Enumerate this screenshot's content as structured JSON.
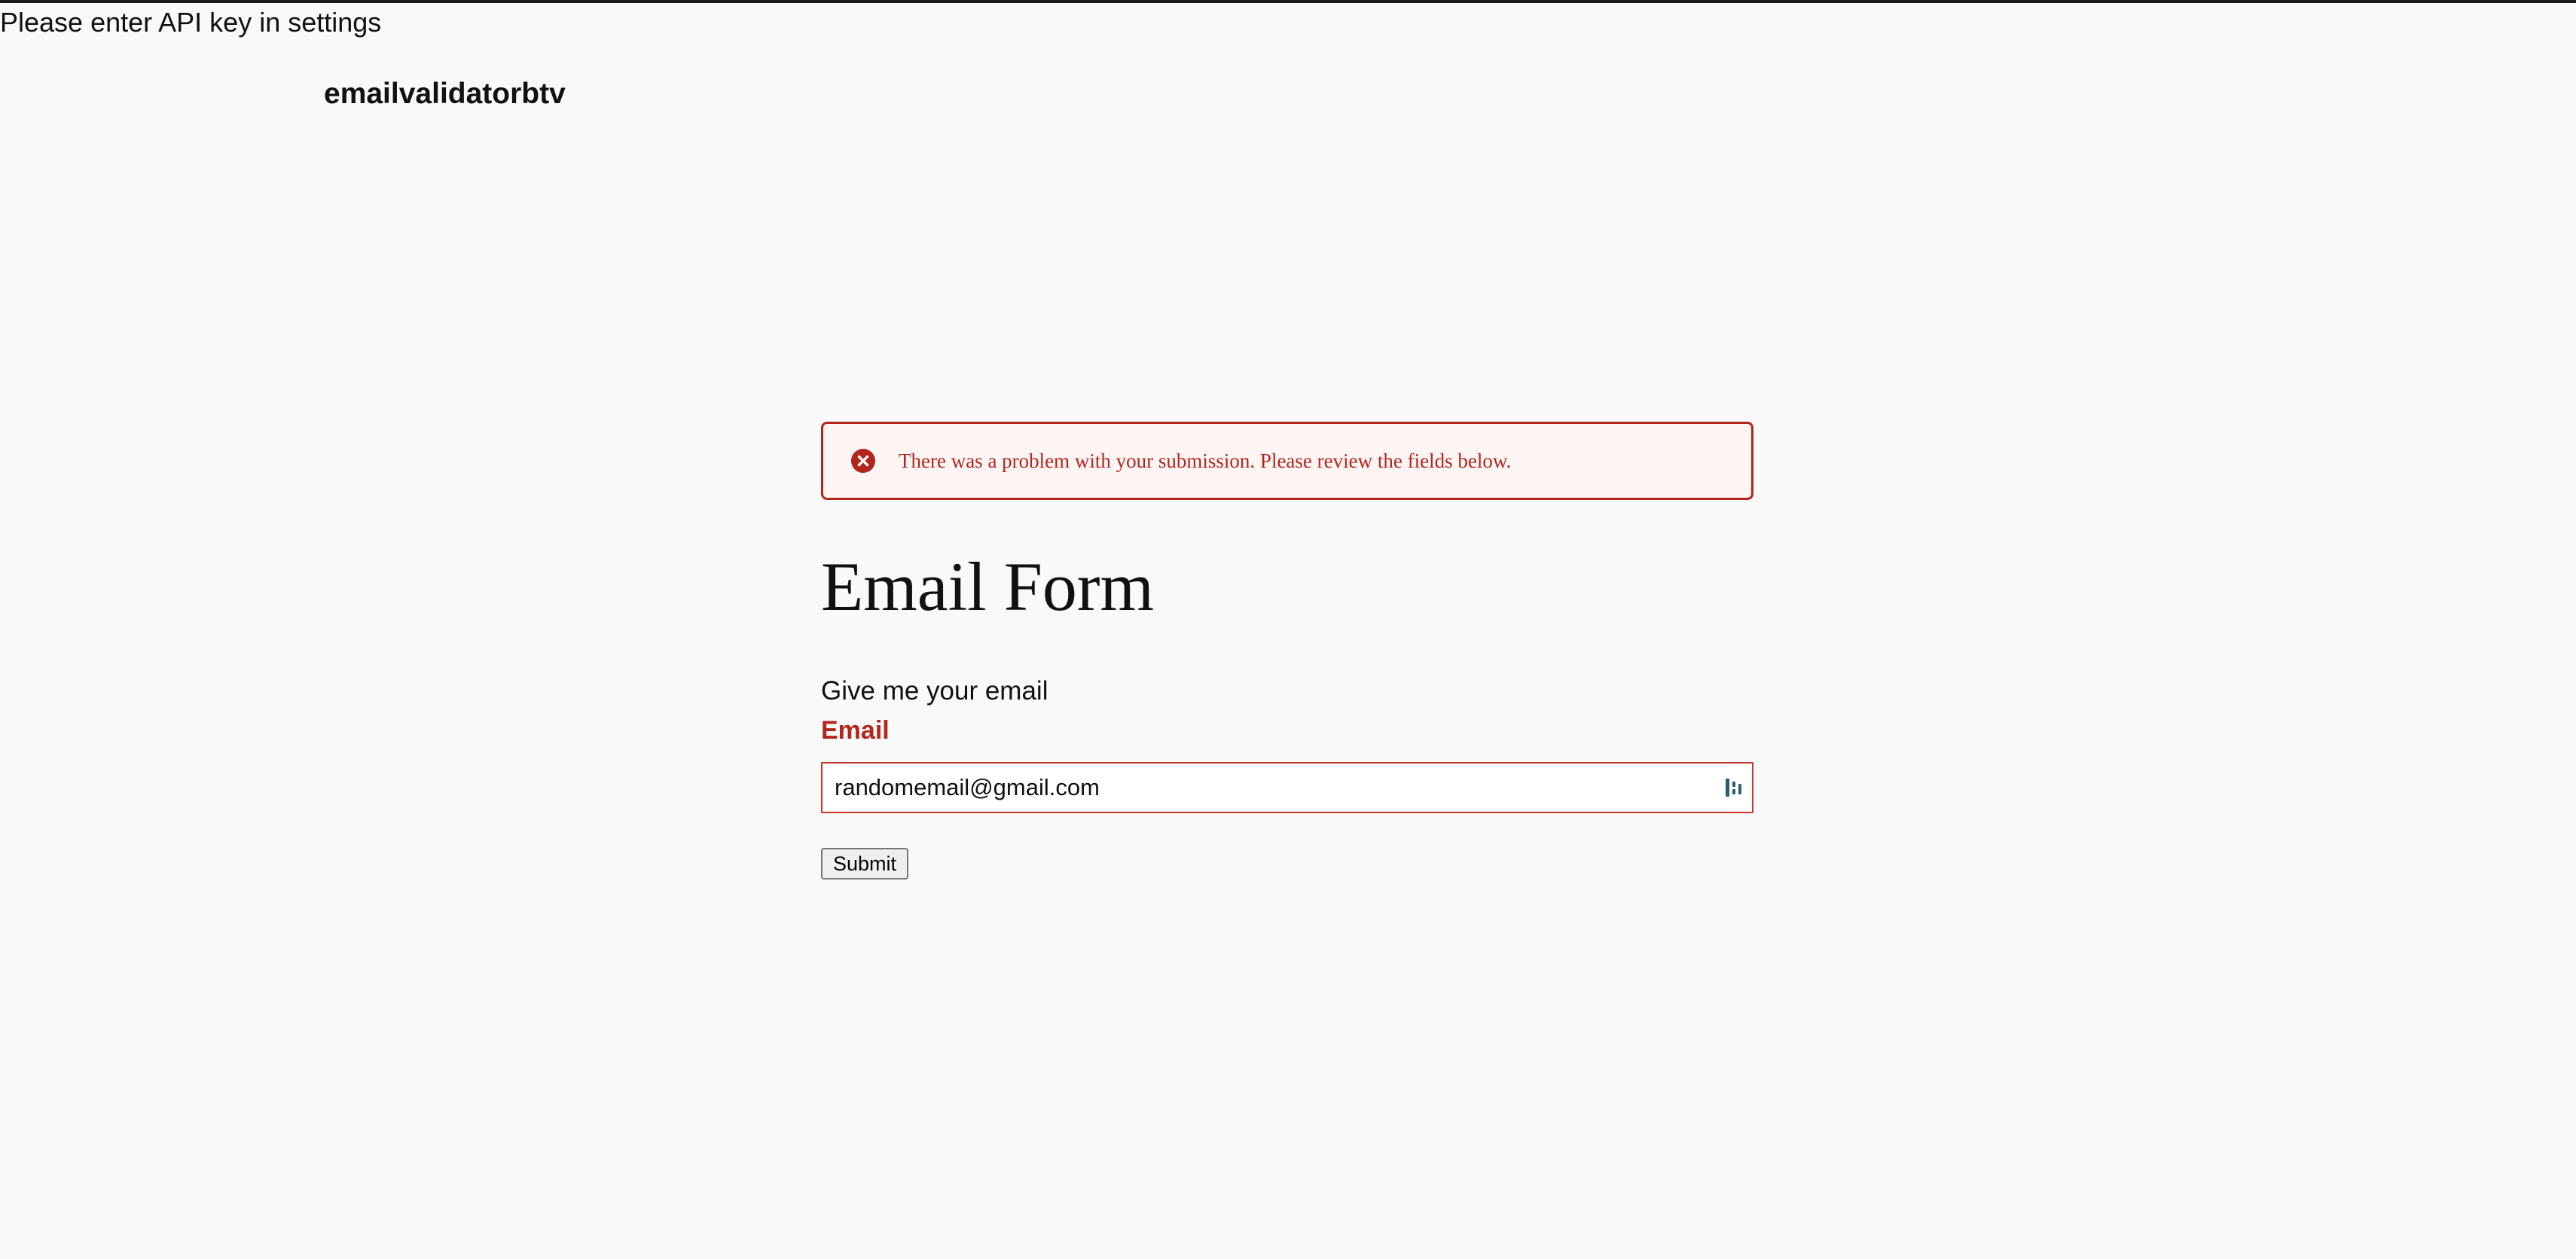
{
  "notice": {
    "api_key_message": "Please enter API key in settings"
  },
  "header": {
    "site_title": "emailvalidatorbtv"
  },
  "error_banner": {
    "icon": "error-circle-x-icon",
    "message": "There was a problem with your submission. Please review the fields below.",
    "color": "#b3261e",
    "background": "#fdf5f4"
  },
  "form": {
    "title": "Email Form",
    "description": "Give me your email",
    "email_label": "Email",
    "email_value": "randomemail@gmail.com",
    "password_manager_icon": "password-manager-icon",
    "submit_label": "Submit"
  }
}
